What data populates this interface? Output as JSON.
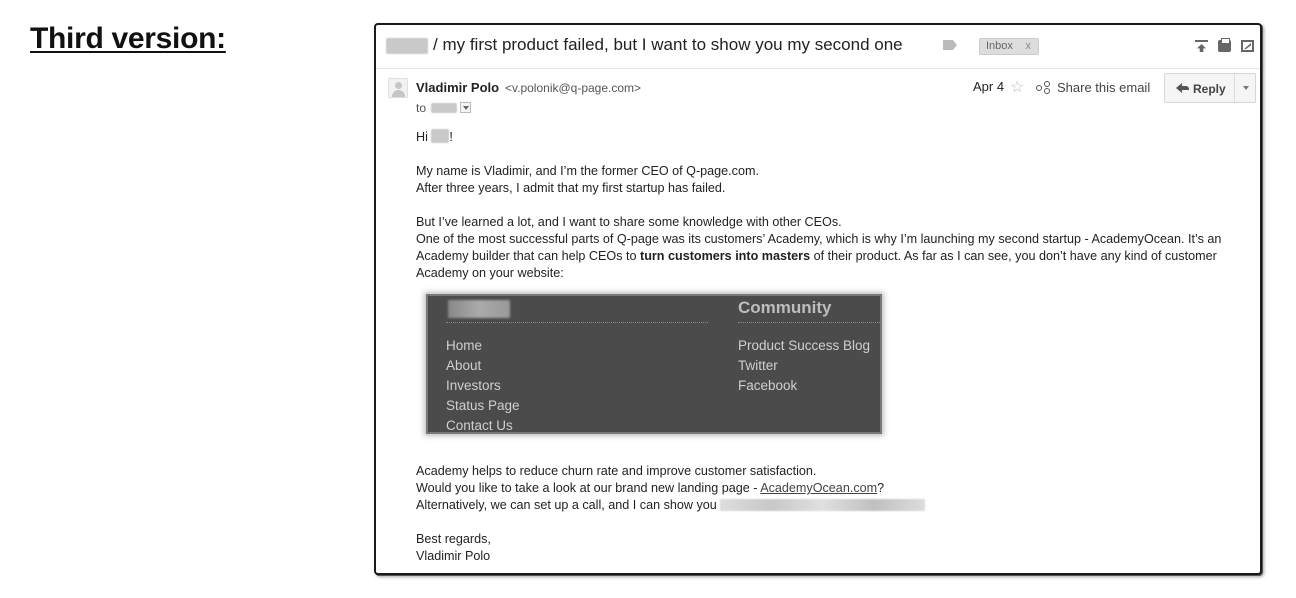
{
  "page": {
    "heading": "Third version:"
  },
  "email": {
    "subject": "/ my first product failed, but I want to show you my second one",
    "label_badge": "Inbox",
    "label_badge_close": "x",
    "sender_name": "Vladimir Polo",
    "sender_email": "<v.polonik@q-page.com>",
    "to_label": "to",
    "date": "Apr 4",
    "star_glyph": "☆",
    "share_label": "Share this email",
    "reply_label": "Reply",
    "greeting_pre": "Hi",
    "greeting_post": "!",
    "p1_l1": "My name is Vladimir, and I’m the former CEO of Q-page.com.",
    "p1_l2": "After three years, I admit that my first startup has failed.",
    "p2_l1": "But I’ve learned a lot, and I want to share some knowledge with other CEOs.",
    "p2_l2_pre": "One of the most successful parts of Q-page was its customers’ Academy, which is why I’m launching my second startup - AcademyOcean. It’s an Academy builder that can help CEOs to ",
    "p2_bold": "turn customers into masters",
    "p2_l2_post": " of their product. As far as I can see, you don’t have any kind of customer Academy on your website:",
    "p3_l1": "Academy helps to reduce churn rate and improve customer satisfaction.",
    "p3_l2_pre": "Would you like to take a look at our brand new landing page - ",
    "p3_link": "AcademyOcean.com",
    "p3_l2_post": "?",
    "p3_l3": "Alternatively, we can set up a call, and I can show you",
    "sign_l1": "Best regards,",
    "sign_l2": "Vladimir Polo"
  },
  "footer_screenshot": {
    "community_title": "Community",
    "left_links": [
      "Home",
      "About",
      "Investors",
      "Status Page",
      "Contact Us"
    ],
    "right_links": [
      "Product Success Blog",
      "Twitter",
      "Facebook"
    ]
  }
}
